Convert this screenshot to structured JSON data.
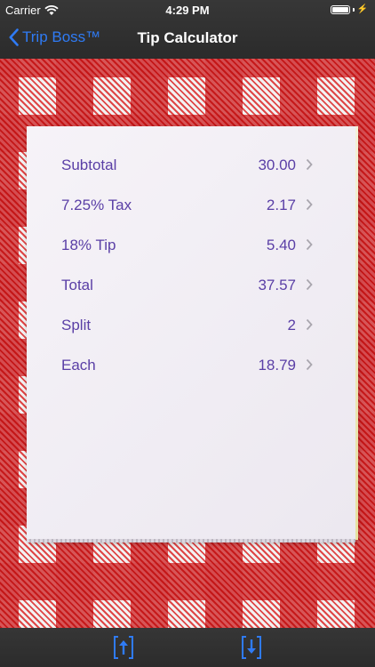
{
  "status_bar": {
    "carrier": "Carrier",
    "time": "4:29 PM",
    "battery_level": 1.0
  },
  "nav": {
    "back_label": "Trip Boss™",
    "title": "Tip Calculator"
  },
  "rows": [
    {
      "label": "Subtotal",
      "value": "30.00"
    },
    {
      "label": "7.25% Tax",
      "value": "2.17"
    },
    {
      "label": "18% Tip",
      "value": "5.40"
    },
    {
      "label": "Total",
      "value": "37.57"
    },
    {
      "label": "Split",
      "value": "2"
    },
    {
      "label": "Each",
      "value": "18.79"
    }
  ],
  "toolbar": {
    "upload_icon": "upload-icon",
    "download_icon": "download-icon"
  },
  "colors": {
    "nav_accent": "#2f7bf5",
    "row_text": "#5a3fa6",
    "tablecloth_red": "#d71419"
  }
}
